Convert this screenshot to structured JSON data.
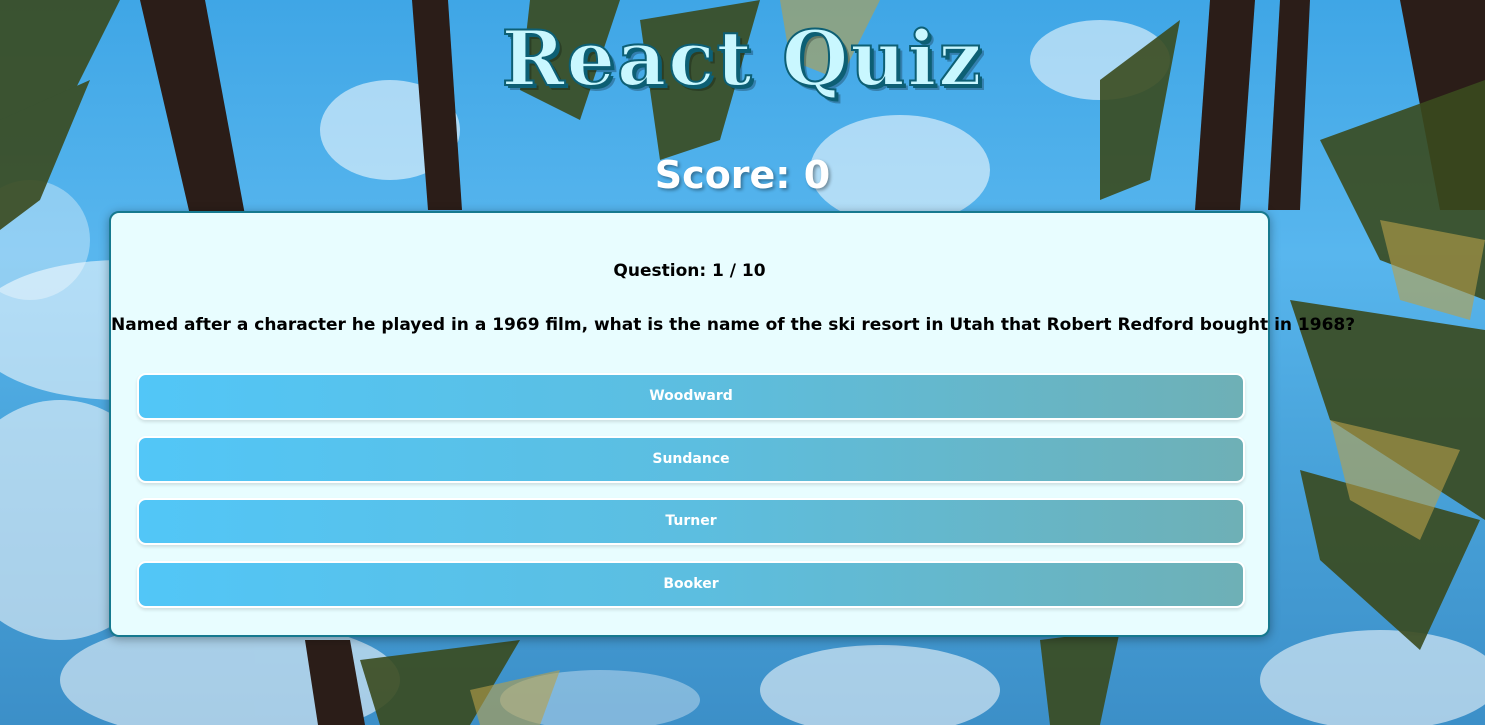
{
  "app": {
    "title": "React Quiz"
  },
  "score": {
    "label": "Score: 0"
  },
  "question": {
    "counter": "Question: 1 / 10",
    "text": "Named after a character he played in a 1969 film, what is the name of the ski resort in Utah that Robert Redford bought in 1968?"
  },
  "answers": [
    {
      "label": "Woodward"
    },
    {
      "label": "Sundance"
    },
    {
      "label": "Turner"
    },
    {
      "label": "Booker"
    }
  ],
  "colors": {
    "title_fill": "#c9f7ff",
    "title_outline": "#0d5f74",
    "card_background": "#e8fdff",
    "card_border": "#16798f",
    "answer_gradient_start": "#52c6f7",
    "answer_gradient_end": "#6eb0b6"
  },
  "background": {
    "icon": "palm-trees-sky-image"
  }
}
